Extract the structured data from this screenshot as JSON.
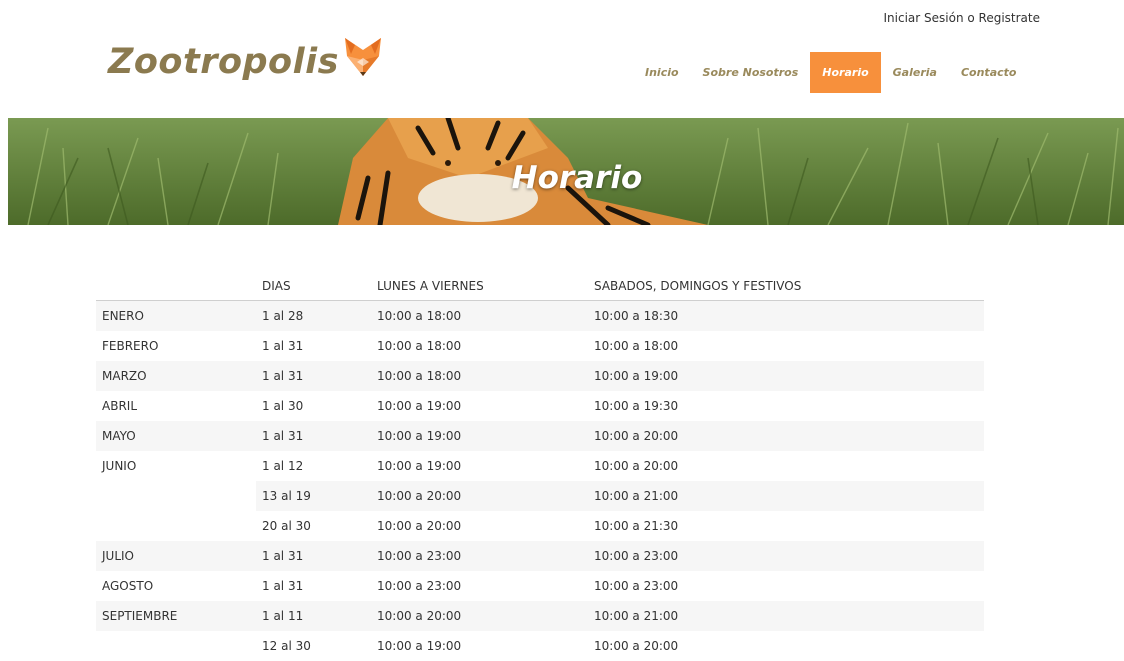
{
  "topbar": {
    "login_text": "Iniciar Sesión o Registrate"
  },
  "logo": {
    "text": "Zootropolis",
    "icon": "fox-icon"
  },
  "nav": [
    {
      "label": "Inicio",
      "active": false
    },
    {
      "label": "Sobre Nosotros",
      "active": false
    },
    {
      "label": "Horario",
      "active": true
    },
    {
      "label": "Galeria",
      "active": false
    },
    {
      "label": "Contacto",
      "active": false
    }
  ],
  "banner": {
    "title": "Horario",
    "image": "tiger-in-grass"
  },
  "colors": {
    "accent": "#f7903c",
    "logo": "#8b7a4f",
    "nav_text": "#9a8a5c"
  },
  "table": {
    "headers": [
      "",
      "DIAS",
      "LUNES A VIERNES",
      "SABADOS, DOMINGOS Y FESTIVOS"
    ],
    "rows": [
      [
        "ENERO",
        "1 al 28",
        "10:00 a 18:00",
        "10:00 a 18:30"
      ],
      [
        "FEBRERO",
        "1 al 31",
        "10:00 a 18:00",
        "10:00 a 18:00"
      ],
      [
        "MARZO",
        "1 al 31",
        "10:00 a 18:00",
        "10:00 a 19:00"
      ],
      [
        "ABRIL",
        "1 al 30",
        "10:00 a 19:00",
        "10:00 a 19:30"
      ],
      [
        "MAYO",
        "1 al 31",
        "10:00 a 19:00",
        "10:00 a 20:00"
      ],
      [
        "JUNIO",
        "1 al 12",
        "10:00 a 19:00",
        "10:00 a 20:00"
      ],
      [
        "",
        "13 al 19",
        "10:00 a 20:00",
        "10:00 a 21:00"
      ],
      [
        "",
        "20 al 30",
        "10:00 a 20:00",
        "10:00 a 21:30"
      ],
      [
        "JULIO",
        "1 al 31",
        "10:00 a 23:00",
        "10:00 a 23:00"
      ],
      [
        "AGOSTO",
        "1 al 31",
        "10:00 a 23:00",
        "10:00 a 23:00"
      ],
      [
        "SEPTIEMBRE",
        "1 al 11",
        "10:00 a 20:00",
        "10:00 a 21:00"
      ],
      [
        "",
        "12 al 30",
        "10:00 a 19:00",
        "10:00 a 20:00"
      ]
    ]
  }
}
